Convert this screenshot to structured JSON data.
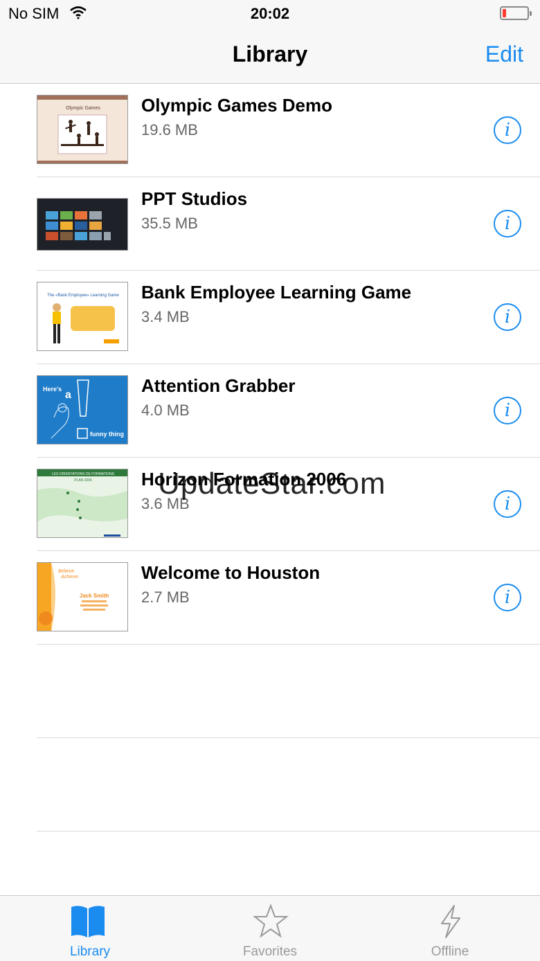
{
  "status": {
    "carrier": "No SIM",
    "time": "20:02"
  },
  "nav": {
    "title": "Library",
    "edit": "Edit"
  },
  "items": [
    {
      "name": "Olympic Games Demo",
      "size": "19.6 MB"
    },
    {
      "name": "PPT Studios",
      "size": "35.5 MB"
    },
    {
      "name": "Bank Employee Learning Game",
      "size": "3.4 MB"
    },
    {
      "name": "Attention Grabber",
      "size": "4.0 MB"
    },
    {
      "name": "Horizon Formation 2006",
      "size": "3.6 MB"
    },
    {
      "name": "Welcome to Houston",
      "size": "2.7 MB"
    }
  ],
  "thumbs": {
    "olympic": "Olympic Games",
    "bank": "The «Bank Employee» Learning Game",
    "attention_heres": "Here's",
    "attention_a": "a",
    "attention_funny": "funny thing",
    "horizon": "LES ORIENTATIONS DE FORMATIONS",
    "horizon_plan": "PLAN 2006",
    "houston_name": "Jack Smith"
  },
  "watermark": "UpdateStar.com",
  "tabs": [
    {
      "label": "Library",
      "icon": "book-icon",
      "active": true
    },
    {
      "label": "Favorites",
      "icon": "star-icon",
      "active": false
    },
    {
      "label": "Offline",
      "icon": "lightning-icon",
      "active": false
    }
  ],
  "colors": {
    "accent": "#1a8cf0",
    "battery_low": "#ff3b30"
  }
}
